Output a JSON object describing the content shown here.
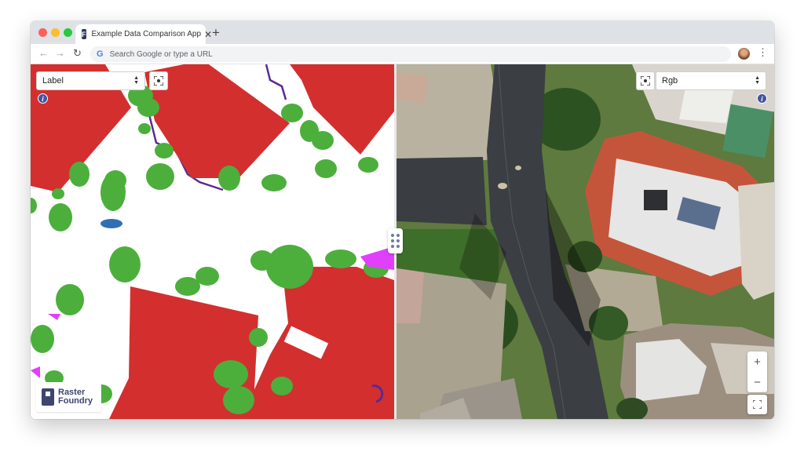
{
  "browser": {
    "tab_title": "Example Data Comparison App",
    "favicon_letter": "F",
    "tab_close": "✕",
    "new_tab": "+",
    "back": "←",
    "forward": "→",
    "reload": "↻",
    "google_g": "G",
    "address_placeholder": "Search Google or type a URL",
    "menu": "⋮"
  },
  "left_pane": {
    "layer_select": "Label",
    "info": "i",
    "logo_line1": "Raster",
    "logo_line2": "Foundry"
  },
  "right_pane": {
    "layer_select": "Rgb",
    "info": "i",
    "zoom_in": "+",
    "zoom_out": "−"
  },
  "colors": {
    "building": "#d32f2f",
    "tree": "#4caf3c",
    "water": "#2f6fb5",
    "fence": "#5b2a91",
    "pool_deck": "#e040fb",
    "road": "#3a3d41",
    "roof_tile": "#c4553b",
    "grass": "#3d7a2a",
    "brand": "#3d4570"
  }
}
